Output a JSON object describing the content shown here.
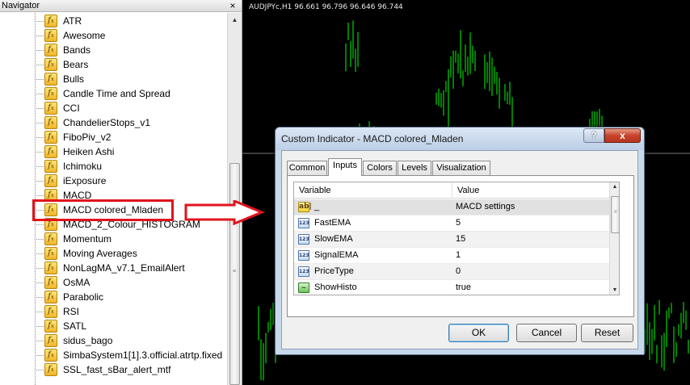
{
  "navigator": {
    "title": "Navigator",
    "close_label": "×",
    "items": [
      {
        "label": "ATR"
      },
      {
        "label": "Awesome"
      },
      {
        "label": "Bands"
      },
      {
        "label": "Bears"
      },
      {
        "label": "Bulls"
      },
      {
        "label": "Candle Time and Spread"
      },
      {
        "label": "CCI"
      },
      {
        "label": "ChandelierStops_v1"
      },
      {
        "label": "FiboPiv_v2"
      },
      {
        "label": "Heiken Ashi"
      },
      {
        "label": "Ichimoku"
      },
      {
        "label": "iExposure"
      },
      {
        "label": "MACD"
      },
      {
        "label": "MACD colored_Mladen"
      },
      {
        "label": "MACD_2_Colour_HISTOGRAM"
      },
      {
        "label": "Momentum"
      },
      {
        "label": "Moving Averages"
      },
      {
        "label": "NonLagMA_v7.1_EmailAlert"
      },
      {
        "label": "OsMA"
      },
      {
        "label": "Parabolic"
      },
      {
        "label": "RSI"
      },
      {
        "label": "SATL"
      },
      {
        "label": "sidus_bago"
      },
      {
        "label": "SimbaSystem1[1].3.official.atrtp.fixed"
      },
      {
        "label": "SSL_fast_sBar_alert_mtf"
      }
    ],
    "highlighted_item": "MACD colored_Mladen"
  },
  "chart": {
    "title": "AUDJPYc,H1  96.661 96.796 96.646 96.744",
    "background_color": "#000000",
    "bar_color": "#00ff00"
  },
  "dialog": {
    "title": "Custom Indicator - MACD colored_Mladen",
    "help_label": "?",
    "close_label": "x",
    "tabs": [
      {
        "label": "Common",
        "active": false
      },
      {
        "label": "Inputs",
        "active": true
      },
      {
        "label": "Colors",
        "active": false
      },
      {
        "label": "Levels",
        "active": false
      },
      {
        "label": "Visualization",
        "active": false
      }
    ],
    "table": {
      "col_variable": "Variable",
      "col_value": "Value",
      "rows": [
        {
          "icon": "ab",
          "variable": "_",
          "value": "MACD settings"
        },
        {
          "icon": "123",
          "variable": "FastEMA",
          "value": "5"
        },
        {
          "icon": "123",
          "variable": "SlowEMA",
          "value": "15"
        },
        {
          "icon": "123",
          "variable": "SignalEMA",
          "value": "1"
        },
        {
          "icon": "123",
          "variable": "PriceType",
          "value": "0"
        },
        {
          "icon": "bool",
          "variable": "ShowHisto",
          "value": "true"
        }
      ]
    },
    "buttons": {
      "ok": "OK",
      "cancel": "Cancel",
      "reset": "Reset"
    }
  },
  "colors": {
    "highlight_red": "#e0141c",
    "dialog_frame": "#c9d9ec",
    "close_button": "#c6432a"
  }
}
